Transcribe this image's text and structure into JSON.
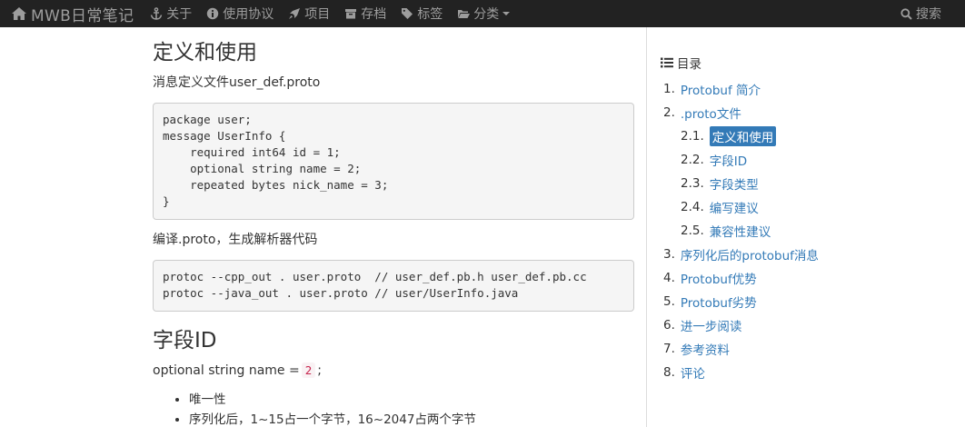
{
  "navbar": {
    "brand": "MWB日常笔记",
    "items": [
      {
        "label": "关于",
        "icon": "anchor-icon"
      },
      {
        "label": "使用协议",
        "icon": "info-circle-icon"
      },
      {
        "label": "项目",
        "icon": "rocket-icon"
      },
      {
        "label": "存档",
        "icon": "archive-icon"
      },
      {
        "label": "标签",
        "icon": "tag-icon"
      },
      {
        "label": "分类",
        "icon": "folder-icon"
      }
    ],
    "search": "搜索"
  },
  "content": {
    "section1_title": "定义和使用",
    "para1": "消息定义文件user_def.proto",
    "code1": "package user;\nmessage UserInfo {\n    required int64 id = 1;\n    optional string name = 2;\n    repeated bytes nick_name = 3;\n}",
    "para2": "编译.proto，生成解析器代码",
    "code2": "protoc --cpp_out . user.proto  // user_def.pb.h user_def.pb.cc\nprotoc --java_out . user.proto // user/UserInfo.java",
    "section2_title": "字段ID",
    "para3_text": "optional string name =",
    "para3_code": "2",
    "para3_suffix": ";",
    "bullets": [
      "唯一性",
      "序列化后，1~15占一个字节，16~2047占两个字节"
    ]
  },
  "toc": {
    "title": "目录",
    "items": [
      {
        "num": "1.",
        "label": "Protobuf 简介"
      },
      {
        "num": "2.",
        "label": ".proto文件"
      },
      {
        "num": "2.1.",
        "label": "定义和使用"
      },
      {
        "num": "2.2.",
        "label": "字段ID"
      },
      {
        "num": "2.3.",
        "label": "字段类型"
      },
      {
        "num": "2.4.",
        "label": "编写建议"
      },
      {
        "num": "2.5.",
        "label": "兼容性建议"
      },
      {
        "num": "3.",
        "label": "序列化后的protobuf消息"
      },
      {
        "num": "4.",
        "label": "Protobuf优势"
      },
      {
        "num": "5.",
        "label": "Protobuf劣势"
      },
      {
        "num": "6.",
        "label": "进一步阅读"
      },
      {
        "num": "7.",
        "label": "参考资料"
      },
      {
        "num": "8.",
        "label": "评论"
      }
    ]
  },
  "colors": {
    "navbar_bg": "#222222",
    "nav_text": "#9d9d9d",
    "link": "#337ab7",
    "active_bg": "#337ab7"
  }
}
